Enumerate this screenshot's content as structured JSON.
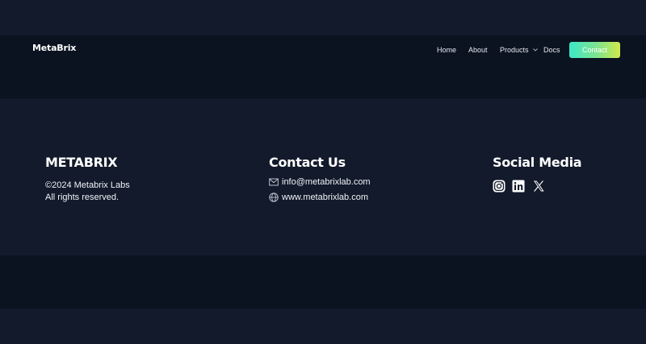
{
  "nav": {
    "logo": "MetaBrix",
    "links": [
      "Home",
      "About",
      "Products",
      "Docs"
    ],
    "contact_button": "Contact"
  },
  "footer": {
    "brand": {
      "title": "METABRIX",
      "copyright": "©2024 Metabrix Labs",
      "rights": "All rights reserved."
    },
    "contact": {
      "title": "Contact Us",
      "email": "info@metabrixlab.com",
      "website": "www.metabrixlab.com"
    },
    "social": {
      "title": "Social Media",
      "icons": [
        "instagram-icon",
        "linkedin-icon",
        "x-icon"
      ]
    }
  },
  "colors": {
    "page_bg": "#121a2b",
    "nav_bg": "#0b1220",
    "button_gradient": [
      "#3ce8c8",
      "#7fe38e",
      "#d2ea4a"
    ]
  }
}
